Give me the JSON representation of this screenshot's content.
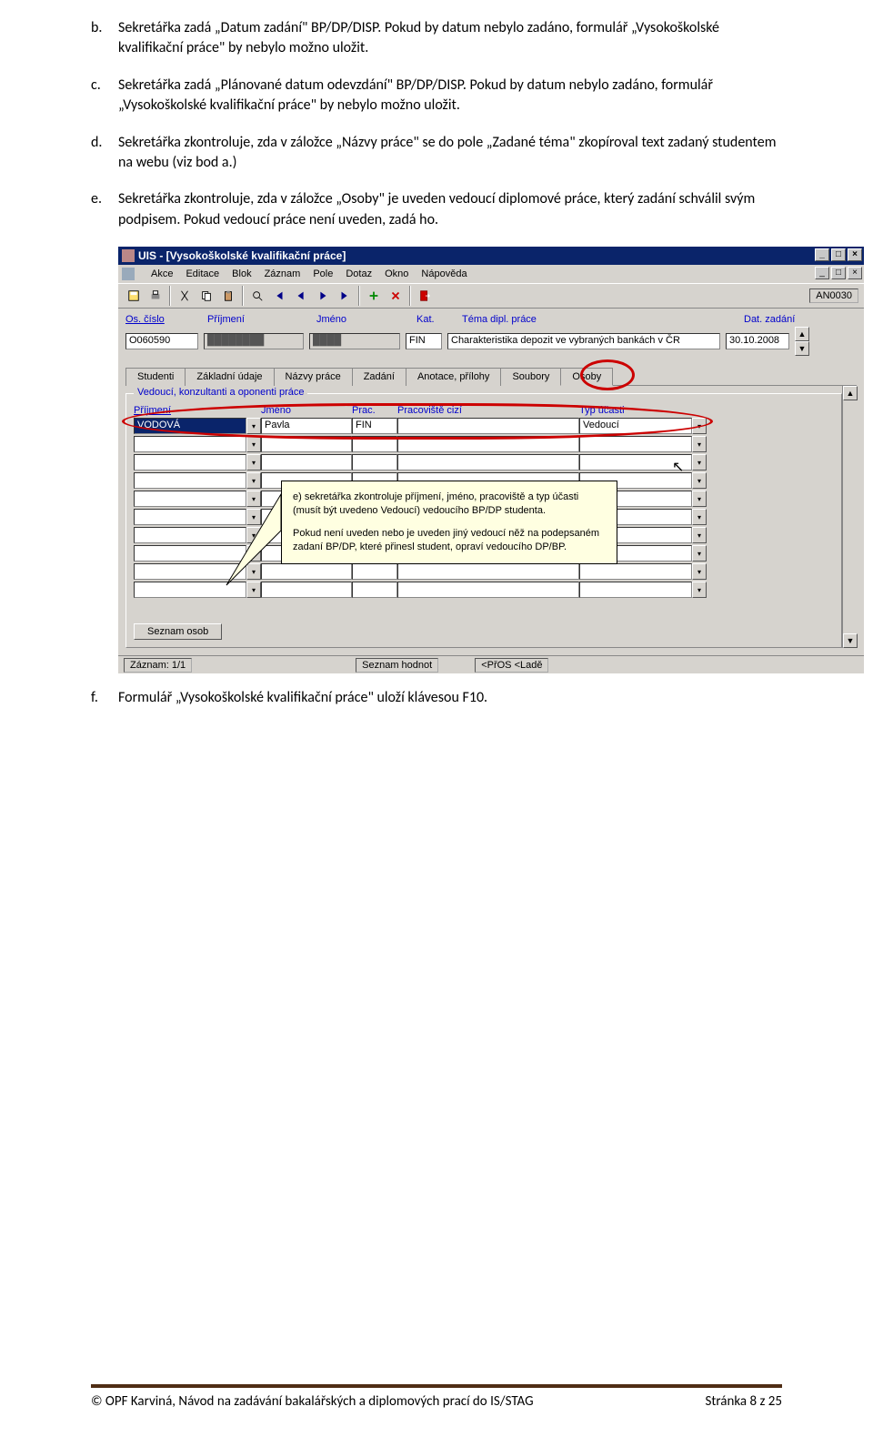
{
  "doc": {
    "item_b": {
      "marker": "b.",
      "text": "Sekretářka zadá „Datum zadání\" BP/DP/DISP. Pokud by datum nebylo zadáno, formulář „Vysokoškolské kvalifikační práce\" by nebylo možno uložit."
    },
    "item_c": {
      "marker": "c.",
      "text": "Sekretářka zadá „Plánované datum odevzdání\" BP/DP/DISP. Pokud by datum nebylo zadáno, formulář „Vysokoškolské kvalifikační práce\" by nebylo možno uložit."
    },
    "item_d": {
      "marker": "d.",
      "text": "Sekretářka zkontroluje, zda v záložce „Názvy práce\" se do pole „Zadané téma\" zkopíroval text zadaný studentem na webu (viz bod a.)"
    },
    "item_e": {
      "marker": "e.",
      "text": "Sekretářka zkontroluje, zda v záložce „Osoby\" je uveden vedoucí diplomové práce, který zadání schválil svým podpisem. Pokud vedoucí práce není uveden, zadá ho."
    },
    "item_f": {
      "marker": "f.",
      "text": "Formulář „Vysokoškolské kvalifikační práce\" uloží klávesou F10."
    }
  },
  "app": {
    "title": "UIS - [Vysokoškolské kvalifikační práce]",
    "menus": [
      "Akce",
      "Editace",
      "Blok",
      "Záznam",
      "Pole",
      "Dotaz",
      "Okno",
      "Nápověda"
    ],
    "code": "AN0030",
    "fields": {
      "labels": [
        "Os. číslo",
        "Příjmení",
        "Jméno",
        "Kat.",
        "Téma dipl. práce",
        "Dat. zadání"
      ],
      "os_cislo": "O060590",
      "prijmeni": "████████",
      "jmeno": "████",
      "kat": "FIN",
      "tema": "Charakteristika depozit ve vybraných bankách v ČR",
      "dat_zadani": "30.10.2008"
    },
    "tabs": [
      "Studenti",
      "Základní údaje",
      "Názvy práce",
      "Zadání",
      "Anotace, přílohy",
      "Soubory",
      "Osoby"
    ],
    "group_title": "Vedoucí, konzultanti a oponenti práce",
    "cols": [
      "Příjmení",
      "Jméno",
      "Prac.",
      "Pracoviště cizí",
      "Typ účasti"
    ],
    "row": {
      "prijmeni": "VODOVÁ",
      "jmeno": "Pavla",
      "prac": "FIN",
      "pracoviste_cizi": "",
      "typ": "Vedoucí"
    },
    "callout_line1": "e) sekretářka zkontroluje příjmení, jméno, pracoviště a typ účasti (musít být uvedeno Vedoucí) vedoucího BP/DP studenta.",
    "callout_line2": "Pokud není uveden nebo je uveden jiný vedoucí něž na podepsaném zadaní BP/DP, které přinesl student, opraví vedoucího DP/BP.",
    "seznam_btn": "Seznam osob",
    "status": {
      "record": "Záznam: 1/1",
      "mid": "Seznam hodnot",
      "right": "<PřOS <Ladě"
    }
  },
  "footer": {
    "left": "© OPF Karviná, Návod na zadávání bakalářských a diplomových prací do IS/STAG",
    "right": "Stránka 8 z 25"
  }
}
